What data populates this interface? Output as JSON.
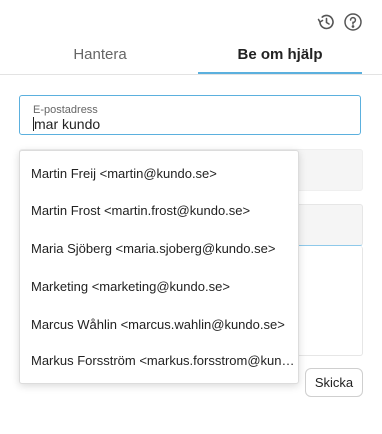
{
  "toolbar": {
    "history_icon": "history-icon",
    "help_icon": "help-icon"
  },
  "tabs": [
    {
      "label": "Hantera",
      "active": false
    },
    {
      "label": "Be om hjälp",
      "active": true
    }
  ],
  "email": {
    "label": "E-postadress",
    "value": "mar kundo"
  },
  "suggestions": [
    "Martin Freij <martin@kundo.se>",
    "Martin Frost <martin.frost@kundo.se>",
    "Maria Sjöberg <maria.sjoberg@kundo.se>",
    "Marketing <marketing@kundo.se>",
    "Marcus Wåhlin <marcus.wahlin@kundo.se>",
    "Markus Forsström <markus.forsstrom@kundo.se>"
  ],
  "actions": {
    "send_label": "Skicka"
  },
  "colors": {
    "accent": "#5bb0de",
    "field_bg": "#f5f5f5"
  }
}
